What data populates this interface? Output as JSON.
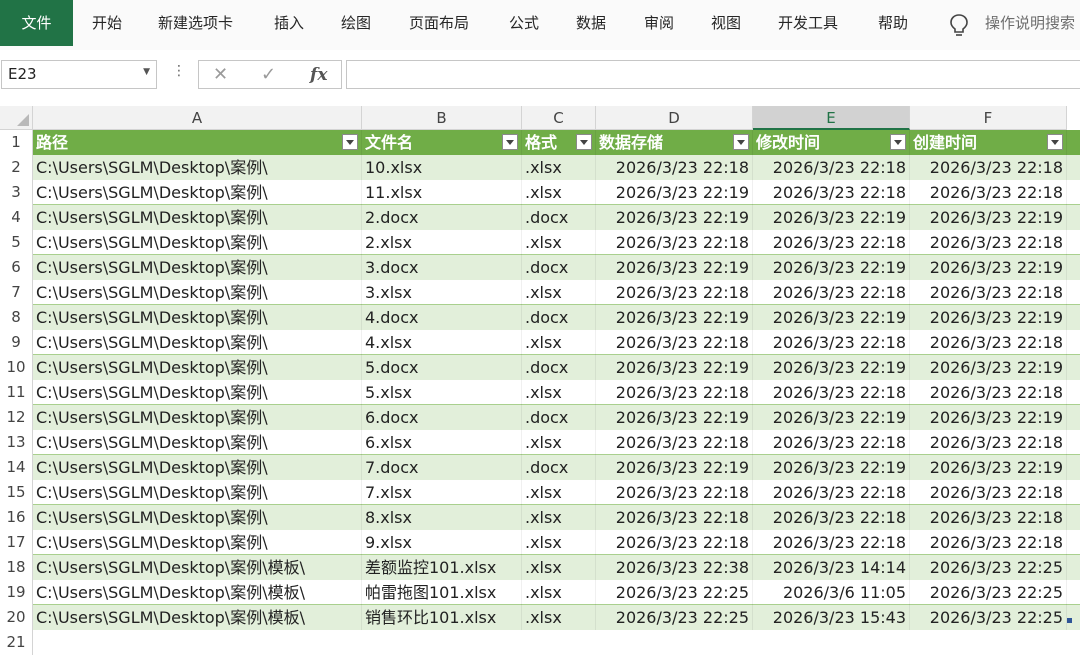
{
  "ribbon": {
    "tabs": [
      "文件",
      "开始",
      "新建选项卡",
      "插入",
      "绘图",
      "页面布局",
      "公式",
      "数据",
      "审阅",
      "视图",
      "开发工具",
      "帮助"
    ],
    "tell_me": "操作说明搜索"
  },
  "formula_bar": {
    "name_box": "E23",
    "fx": "fx",
    "value": ""
  },
  "sheet": {
    "columns": [
      "A",
      "B",
      "C",
      "D",
      "E",
      "F"
    ],
    "selected_column": "E",
    "row_numbers": [
      "1",
      "2",
      "3",
      "4",
      "5",
      "6",
      "7",
      "8",
      "9",
      "10",
      "11",
      "12",
      "13",
      "14",
      "15",
      "16",
      "17",
      "18",
      "19",
      "20",
      "21"
    ],
    "header": [
      "路径",
      "文件名",
      "格式",
      "数据存储",
      "修改时间",
      "创建时间"
    ],
    "rows": [
      [
        "C:\\Users\\SGLM\\Desktop\\案例\\",
        "10.xlsx",
        ".xlsx",
        "2026/3/23 22:18",
        "2026/3/23 22:18",
        "2026/3/23 22:18"
      ],
      [
        "C:\\Users\\SGLM\\Desktop\\案例\\",
        "11.xlsx",
        ".xlsx",
        "2026/3/23 22:19",
        "2026/3/23 22:18",
        "2026/3/23 22:18"
      ],
      [
        "C:\\Users\\SGLM\\Desktop\\案例\\",
        "2.docx",
        ".docx",
        "2026/3/23 22:19",
        "2026/3/23 22:19",
        "2026/3/23 22:19"
      ],
      [
        "C:\\Users\\SGLM\\Desktop\\案例\\",
        "2.xlsx",
        ".xlsx",
        "2026/3/23 22:18",
        "2026/3/23 22:18",
        "2026/3/23 22:18"
      ],
      [
        "C:\\Users\\SGLM\\Desktop\\案例\\",
        "3.docx",
        ".docx",
        "2026/3/23 22:19",
        "2026/3/23 22:19",
        "2026/3/23 22:19"
      ],
      [
        "C:\\Users\\SGLM\\Desktop\\案例\\",
        "3.xlsx",
        ".xlsx",
        "2026/3/23 22:18",
        "2026/3/23 22:18",
        "2026/3/23 22:18"
      ],
      [
        "C:\\Users\\SGLM\\Desktop\\案例\\",
        "4.docx",
        ".docx",
        "2026/3/23 22:19",
        "2026/3/23 22:19",
        "2026/3/23 22:19"
      ],
      [
        "C:\\Users\\SGLM\\Desktop\\案例\\",
        "4.xlsx",
        ".xlsx",
        "2026/3/23 22:18",
        "2026/3/23 22:18",
        "2026/3/23 22:18"
      ],
      [
        "C:\\Users\\SGLM\\Desktop\\案例\\",
        "5.docx",
        ".docx",
        "2026/3/23 22:19",
        "2026/3/23 22:19",
        "2026/3/23 22:19"
      ],
      [
        "C:\\Users\\SGLM\\Desktop\\案例\\",
        "5.xlsx",
        ".xlsx",
        "2026/3/23 22:18",
        "2026/3/23 22:18",
        "2026/3/23 22:18"
      ],
      [
        "C:\\Users\\SGLM\\Desktop\\案例\\",
        "6.docx",
        ".docx",
        "2026/3/23 22:19",
        "2026/3/23 22:19",
        "2026/3/23 22:19"
      ],
      [
        "C:\\Users\\SGLM\\Desktop\\案例\\",
        "6.xlsx",
        ".xlsx",
        "2026/3/23 22:18",
        "2026/3/23 22:18",
        "2026/3/23 22:18"
      ],
      [
        "C:\\Users\\SGLM\\Desktop\\案例\\",
        "7.docx",
        ".docx",
        "2026/3/23 22:19",
        "2026/3/23 22:19",
        "2026/3/23 22:19"
      ],
      [
        "C:\\Users\\SGLM\\Desktop\\案例\\",
        "7.xlsx",
        ".xlsx",
        "2026/3/23 22:18",
        "2026/3/23 22:18",
        "2026/3/23 22:18"
      ],
      [
        "C:\\Users\\SGLM\\Desktop\\案例\\",
        "8.xlsx",
        ".xlsx",
        "2026/3/23 22:18",
        "2026/3/23 22:18",
        "2026/3/23 22:18"
      ],
      [
        "C:\\Users\\SGLM\\Desktop\\案例\\",
        "9.xlsx",
        ".xlsx",
        "2026/3/23 22:18",
        "2026/3/23 22:18",
        "2026/3/23 22:18"
      ],
      [
        "C:\\Users\\SGLM\\Desktop\\案例\\模板\\",
        "差额监控101.xlsx",
        ".xlsx",
        "2026/3/23 22:38",
        "2026/3/23 14:14",
        "2026/3/23 22:25"
      ],
      [
        "C:\\Users\\SGLM\\Desktop\\案例\\模板\\",
        "帕雷拖图101.xlsx",
        ".xlsx",
        "2026/3/23 22:25",
        "2026/3/6 11:05",
        "2026/3/23 22:25"
      ],
      [
        "C:\\Users\\SGLM\\Desktop\\案例\\模板\\",
        "销售环比101.xlsx",
        ".xlsx",
        "2026/3/23 22:25",
        "2026/3/23 15:43",
        "2026/3/23 22:25"
      ]
    ]
  },
  "colors": {
    "active_tab": "#217346",
    "table_header": "#70ad47",
    "band": "#e2efda"
  }
}
